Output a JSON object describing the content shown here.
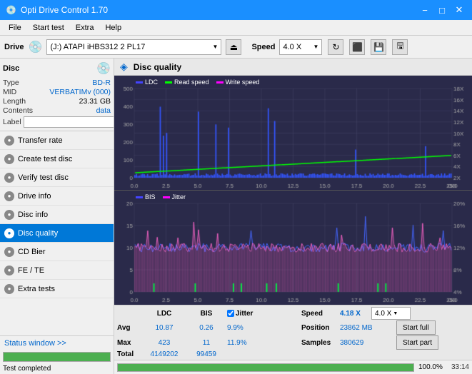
{
  "titlebar": {
    "title": "Opti Drive Control 1.70",
    "min": "−",
    "max": "□",
    "close": "✕"
  },
  "menubar": {
    "items": [
      "File",
      "Start test",
      "Extra",
      "Help"
    ]
  },
  "drivebar": {
    "label": "Drive",
    "drive_text": "(J:)  ATAPI iHBS312  2 PL17",
    "speed_label": "Speed",
    "speed_value": "4.0 X"
  },
  "disc": {
    "title": "Disc",
    "type_label": "Type",
    "type_value": "BD-R",
    "mid_label": "MID",
    "mid_value": "VERBATIMv (000)",
    "length_label": "Length",
    "length_value": "23.31 GB",
    "contents_label": "Contents",
    "contents_value": "data",
    "label_label": "Label"
  },
  "sidebar_nav": [
    {
      "id": "transfer-rate",
      "label": "Transfer rate",
      "active": false
    },
    {
      "id": "create-test-disc",
      "label": "Create test disc",
      "active": false
    },
    {
      "id": "verify-test-disc",
      "label": "Verify test disc",
      "active": false
    },
    {
      "id": "drive-info",
      "label": "Drive info",
      "active": false
    },
    {
      "id": "disc-info",
      "label": "Disc info",
      "active": false
    },
    {
      "id": "disc-quality",
      "label": "Disc quality",
      "active": true
    },
    {
      "id": "cd-bier",
      "label": "CD Bier",
      "active": false
    },
    {
      "id": "fe-te",
      "label": "FE / TE",
      "active": false
    },
    {
      "id": "extra-tests",
      "label": "Extra tests",
      "active": false
    }
  ],
  "status_window": "Status window >>",
  "status_completed": "Test completed",
  "progress_percent": "100.0%",
  "time_display": "33:14",
  "chart_title": "Disc quality",
  "chart": {
    "top_legend": [
      "LDC",
      "Read speed",
      "Write speed"
    ],
    "top_legend_colors": [
      "#4444ff",
      "#00ff00",
      "#ff00ff"
    ],
    "bottom_legend": [
      "BIS",
      "Jitter"
    ],
    "bottom_legend_colors": [
      "#4444ff",
      "#ff00ff"
    ],
    "top_y_right": [
      "18X",
      "16X",
      "14X",
      "12X",
      "10X",
      "8X",
      "6X",
      "4X",
      "2X"
    ],
    "bottom_y_right": [
      "20%",
      "16%",
      "12%",
      "8%",
      "4%"
    ],
    "x_labels": [
      "0.0",
      "2.5",
      "5.0",
      "7.5",
      "10.0",
      "12.5",
      "15.0",
      "17.5",
      "20.0",
      "22.5",
      "25.0"
    ]
  },
  "stats": {
    "col_ldc": "LDC",
    "col_bis": "BIS",
    "jitter_label": "Jitter",
    "speed_label": "Speed",
    "position_label": "Position",
    "samples_label": "Samples",
    "avg_label": "Avg",
    "max_label": "Max",
    "total_label": "Total",
    "avg_ldc": "10.87",
    "avg_bis": "0.26",
    "avg_jitter": "9.9%",
    "max_ldc": "423",
    "max_bis": "11",
    "max_jitter": "11.9%",
    "total_ldc": "4149202",
    "total_bis": "99459",
    "speed_value": "4.18 X",
    "speed_select": "4.0 X",
    "position_value": "23862 MB",
    "samples_value": "380629"
  },
  "buttons": {
    "start_full": "Start full",
    "start_part": "Start part"
  }
}
